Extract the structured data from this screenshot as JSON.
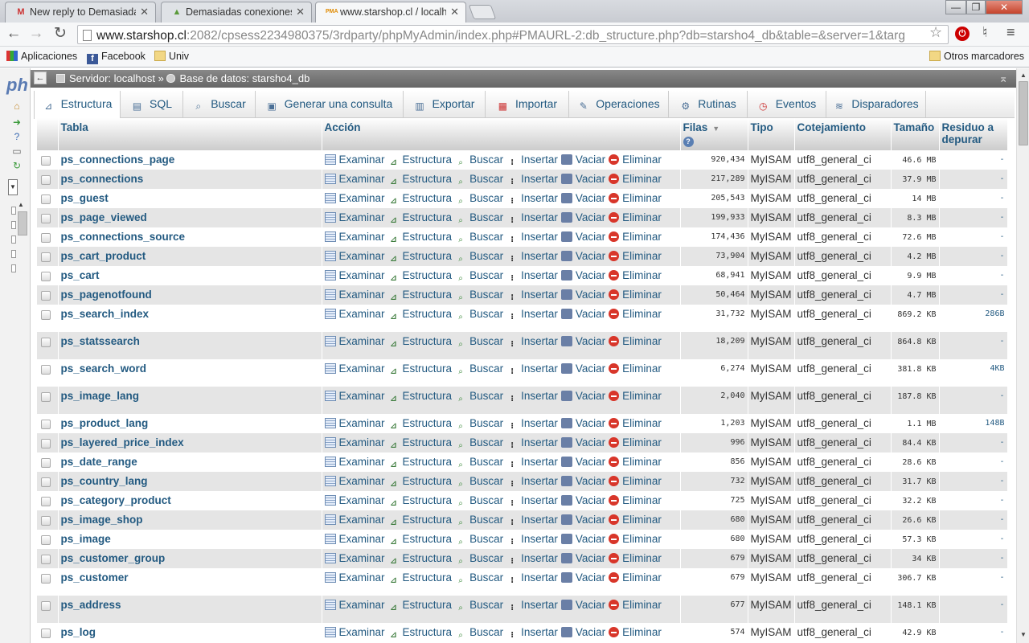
{
  "browser": {
    "tabs": [
      {
        "title": "New reply to Demasiadas conexiones",
        "icon": "M"
      },
      {
        "title": "Demasiadas conexiones re",
        "icon": "▲"
      },
      {
        "title": "www.starshop.cl / localhost",
        "icon": "PMA"
      }
    ],
    "url_host": "www.starshop.cl",
    "url_rest": ":2082/cpsess2234980375/3rdparty/phpMyAdmin/index.php#PMAURL-2:db_structure.php?db=starsho4_db&table=&server=1&targ",
    "bookmarks": [
      "Aplicaciones",
      "Facebook",
      "Univ"
    ],
    "other_bookmarks": "Otros marcadores"
  },
  "breadcrumb": {
    "server": "Servidor: localhost",
    "separator": "»",
    "database": "Base de datos: starsho4_db"
  },
  "tabs": [
    "Estructura",
    "SQL",
    "Buscar",
    "Generar una consulta",
    "Exportar",
    "Importar",
    "Operaciones",
    "Rutinas",
    "Eventos",
    "Disparadores"
  ],
  "table": {
    "headers": {
      "tabla": "Tabla",
      "accion": "Acción",
      "filas": "Filas",
      "tipo": "Tipo",
      "cotejamiento": "Cotejamiento",
      "tamano": "Tamaño",
      "residuo": "Residuo a depurar"
    },
    "actions": [
      "Examinar",
      "Estructura",
      "Buscar",
      "Insertar",
      "Vaciar",
      "Eliminar"
    ],
    "rows": [
      {
        "name": "ps_connections_page",
        "rows": "920,434",
        "type": "MyISAM",
        "collation": "utf8_general_ci",
        "size": "46.6 MB",
        "overhead": "-"
      },
      {
        "name": "ps_connections",
        "rows": "217,289",
        "type": "MyISAM",
        "collation": "utf8_general_ci",
        "size": "37.9 MB",
        "overhead": "-"
      },
      {
        "name": "ps_guest",
        "rows": "205,543",
        "type": "MyISAM",
        "collation": "utf8_general_ci",
        "size": "14 MB",
        "overhead": "-"
      },
      {
        "name": "ps_page_viewed",
        "rows": "199,933",
        "type": "MyISAM",
        "collation": "utf8_general_ci",
        "size": "8.3 MB",
        "overhead": "-"
      },
      {
        "name": "ps_connections_source",
        "rows": "174,436",
        "type": "MyISAM",
        "collation": "utf8_general_ci",
        "size": "72.6 MB",
        "overhead": "-"
      },
      {
        "name": "ps_cart_product",
        "rows": "73,904",
        "type": "MyISAM",
        "collation": "utf8_general_ci",
        "size": "4.2 MB",
        "overhead": "-"
      },
      {
        "name": "ps_cart",
        "rows": "68,941",
        "type": "MyISAM",
        "collation": "utf8_general_ci",
        "size": "9.9 MB",
        "overhead": "-"
      },
      {
        "name": "ps_pagenotfound",
        "rows": "50,464",
        "type": "MyISAM",
        "collation": "utf8_general_ci",
        "size": "4.7 MB",
        "overhead": "-"
      },
      {
        "name": "ps_search_index",
        "rows": "31,732",
        "type": "MyISAM",
        "collation": "utf8_general_ci",
        "size": "869.2 KB",
        "overhead": "286B"
      },
      {
        "name": "ps_statssearch",
        "rows": "18,209",
        "type": "MyISAM",
        "collation": "utf8_general_ci",
        "size": "864.8 KB",
        "overhead": "-"
      },
      {
        "name": "ps_search_word",
        "rows": "6,274",
        "type": "MyISAM",
        "collation": "utf8_general_ci",
        "size": "381.8 KB",
        "overhead": "4KB"
      },
      {
        "name": "ps_image_lang",
        "rows": "2,040",
        "type": "MyISAM",
        "collation": "utf8_general_ci",
        "size": "187.8 KB",
        "overhead": "-"
      },
      {
        "name": "ps_product_lang",
        "rows": "1,203",
        "type": "MyISAM",
        "collation": "utf8_general_ci",
        "size": "1.1 MB",
        "overhead": "148B"
      },
      {
        "name": "ps_layered_price_index",
        "rows": "996",
        "type": "MyISAM",
        "collation": "utf8_general_ci",
        "size": "84.4 KB",
        "overhead": "-"
      },
      {
        "name": "ps_date_range",
        "rows": "856",
        "type": "MyISAM",
        "collation": "utf8_general_ci",
        "size": "28.6 KB",
        "overhead": "-"
      },
      {
        "name": "ps_country_lang",
        "rows": "732",
        "type": "MyISAM",
        "collation": "utf8_general_ci",
        "size": "31.7 KB",
        "overhead": "-"
      },
      {
        "name": "ps_category_product",
        "rows": "725",
        "type": "MyISAM",
        "collation": "utf8_general_ci",
        "size": "32.2 KB",
        "overhead": "-"
      },
      {
        "name": "ps_image_shop",
        "rows": "680",
        "type": "MyISAM",
        "collation": "utf8_general_ci",
        "size": "26.6 KB",
        "overhead": "-"
      },
      {
        "name": "ps_image",
        "rows": "680",
        "type": "MyISAM",
        "collation": "utf8_general_ci",
        "size": "57.3 KB",
        "overhead": "-"
      },
      {
        "name": "ps_customer_group",
        "rows": "679",
        "type": "MyISAM",
        "collation": "utf8_general_ci",
        "size": "34 KB",
        "overhead": "-"
      },
      {
        "name": "ps_customer",
        "rows": "679",
        "type": "MyISAM",
        "collation": "utf8_general_ci",
        "size": "306.7 KB",
        "overhead": "-"
      },
      {
        "name": "ps_address",
        "rows": "677",
        "type": "MyISAM",
        "collation": "utf8_general_ci",
        "size": "148.1 KB",
        "overhead": "-"
      },
      {
        "name": "ps_log",
        "rows": "574",
        "type": "MyISAM",
        "collation": "utf8_general_ci",
        "size": "42.9 KB",
        "overhead": "-"
      }
    ]
  },
  "colors": {
    "link": "#235a81",
    "row_alt": "#e5e5e5",
    "drop": "#d8362a"
  }
}
